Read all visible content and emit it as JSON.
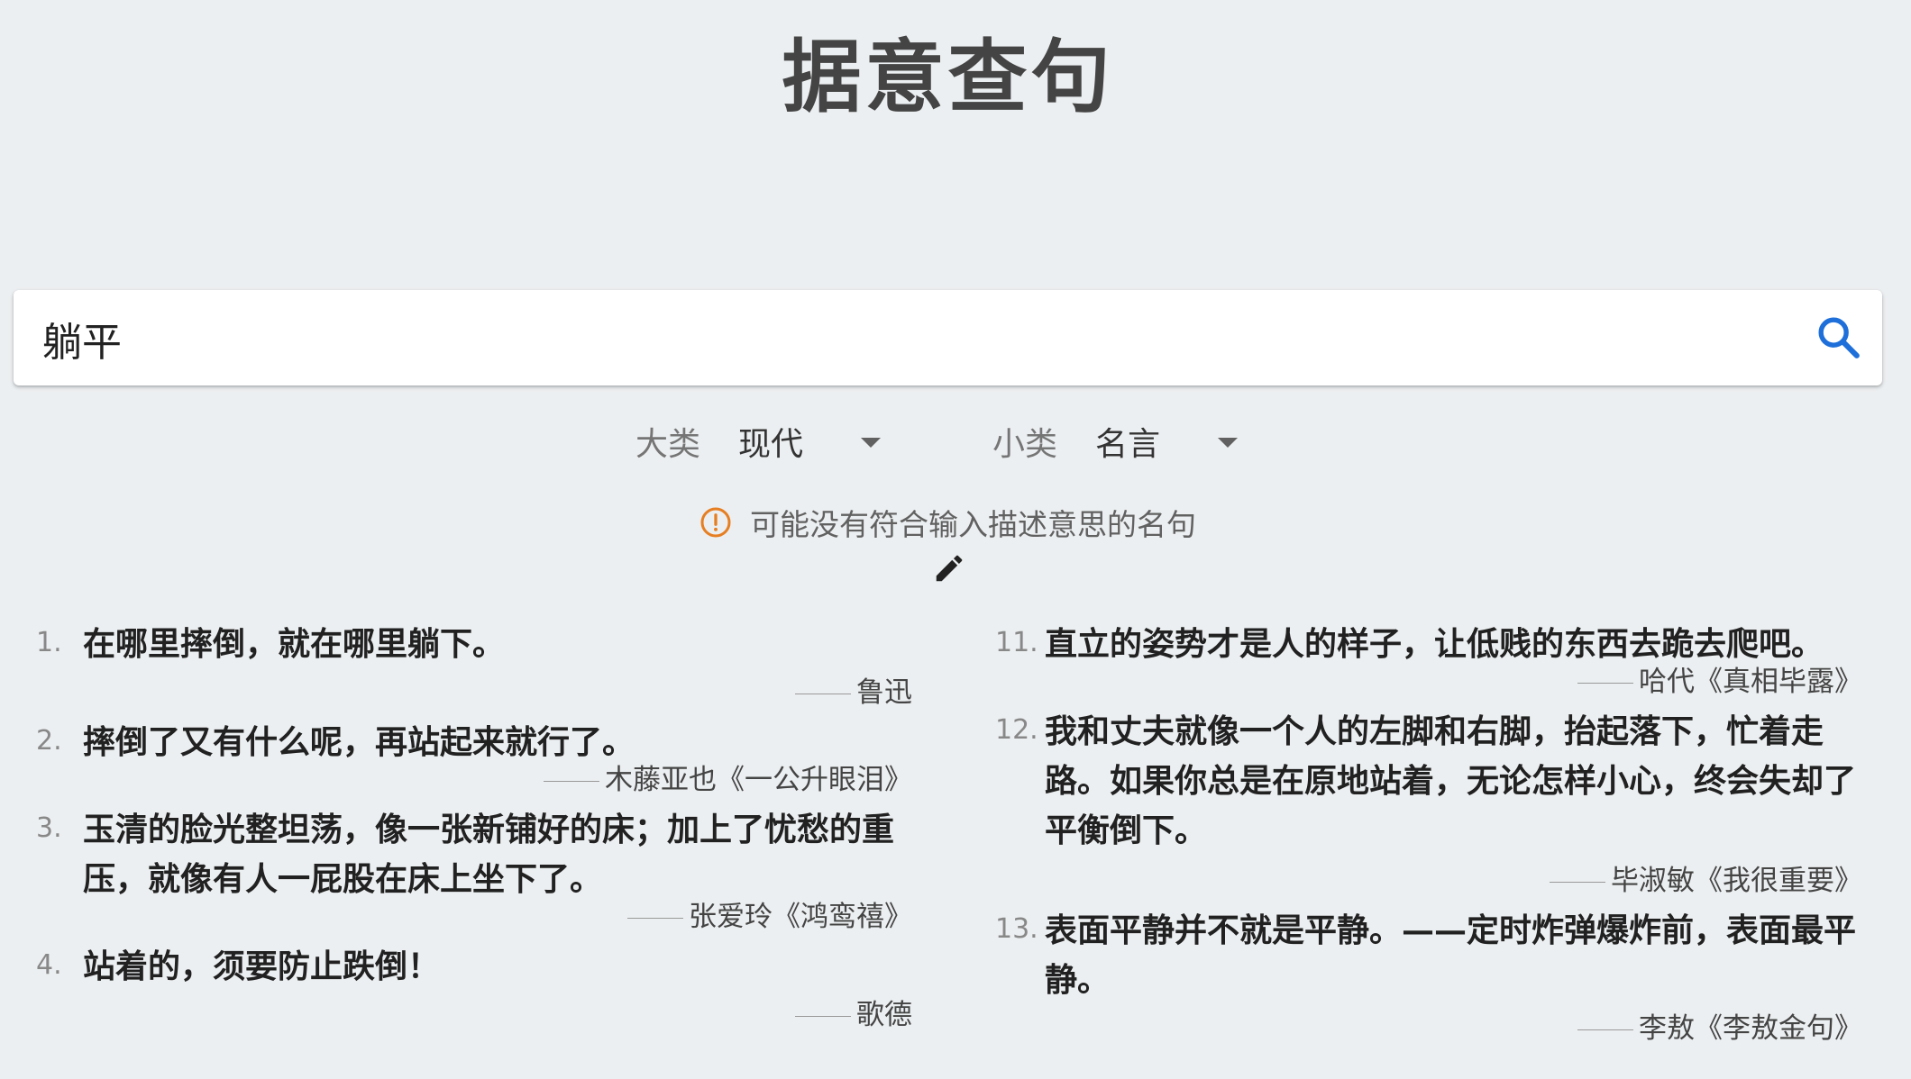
{
  "page": {
    "title": "据意查句"
  },
  "search": {
    "value": "躺平",
    "icon": "search-icon",
    "accent": "#1e6fd9"
  },
  "filters": {
    "category": {
      "label": "大类",
      "value": "现代"
    },
    "subcategory": {
      "label": "小类",
      "value": "名言"
    }
  },
  "notice": {
    "icon": "alert-circle-icon",
    "color": "#e67e22",
    "text": "可能没有符合输入描述意思的名句"
  },
  "edit": {
    "icon": "pencil-icon"
  },
  "results": {
    "left": [
      {
        "num": "1.",
        "quote": "在哪里摔倒，就在哪里躺下。",
        "source": "鲁迅"
      },
      {
        "num": "2.",
        "quote": "摔倒了又有什么呢，再站起来就行了。",
        "source": "木藤亚也《一公升眼泪》"
      },
      {
        "num": "3.",
        "quote": "玉清的脸光整坦荡，像一张新铺好的床；加上了忧愁的重压，就像有人一屁股在床上坐下了。",
        "source": "张爱玲《鸿鸾禧》"
      },
      {
        "num": "4.",
        "quote": "站着的，须要防止跌倒！",
        "source": "歌德"
      }
    ],
    "right": [
      {
        "num": "11.",
        "quote": "直立的姿势才是人的样子，让低贱的东西去跪去爬吧。",
        "source": "哈代《真相毕露》"
      },
      {
        "num": "12.",
        "quote": "我和丈夫就像一个人的左脚和右脚，抬起落下，忙着走路。如果你总是在原地站着，无论怎样小心，终会失却了平衡倒下。",
        "source": "毕淑敏《我很重要》"
      },
      {
        "num": "13.",
        "quote": "表面平静并不就是平静。——定时炸弹爆炸前，表面最平静。",
        "source": "李敖《李敖金句》"
      }
    ]
  }
}
